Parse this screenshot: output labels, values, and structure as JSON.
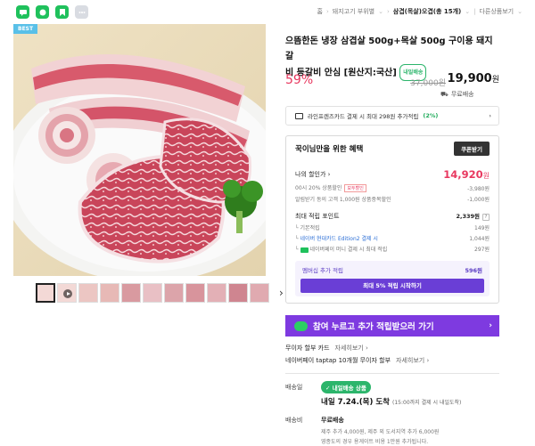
{
  "topbar": {
    "share_icons": [
      "talk-icon",
      "message-icon",
      "bookmark-icon",
      "more-icon"
    ],
    "breadcrumb": [
      {
        "label": "홈"
      },
      {
        "label": "돼지고기 부위별"
      },
      {
        "label": "삼겹(목살)오겹(총 15개)"
      },
      {
        "label": "다른상품보기"
      }
    ]
  },
  "gallery": {
    "badge": "BEST",
    "thumb_count": 11,
    "next_label": "›"
  },
  "product": {
    "title_line1": "으뜸한돈 냉장 삼겹살 500g+목살 500g 구이용 돼지갈",
    "title_line2": "비 등갈비 안심 [원산지:국산]",
    "same_day_badge": "내일배송",
    "discount_rate": "59%",
    "original_price": "37,000원",
    "final_price": "19,900",
    "final_price_unit": "원",
    "shipping_label": "무료배송"
  },
  "card_promo": {
    "text": "라인프렌즈카드 결제 시 최대 298원 추가적립",
    "pct": "(2%)",
    "arrow": "›"
  },
  "benefit": {
    "title": "꾹이님만을 위한 혜택",
    "coupon_button": "쿠폰받기",
    "my_price_label": "나의 할인가",
    "my_price_value": "14,920",
    "my_price_unit": "원",
    "line1_label": "00시 20% 상품할인",
    "line1_tag": "모두할인",
    "line1_value": "-3,980원",
    "line2_label": "알림받기 동의 고객 1,000원 상품중복할인",
    "line2_value": "-1,000원",
    "point_label": "최대 적립 포인트",
    "point_value": "2,339원",
    "base_label": "기본적립",
    "base_value": "149원",
    "card_label": "네이버 현대카드 Edition2 결제 시",
    "card_value": "1,044원",
    "money_label": "네이버페이 머니 결제 시 최대 적립",
    "money_value": "297원",
    "member_label": "멤버십 추가 적립",
    "member_value": "596원",
    "member_button": "최대 5% 적립 시작하기"
  },
  "banner": {
    "text": "참여 누르고 추가 적립받으러 가기",
    "arrow": "›"
  },
  "installment": {
    "row1_label": "무이자 할부 카드",
    "row1_more": "자세히보기",
    "row2_label": "네이버페이 taptap 10개월 무이자 할부",
    "row2_more": "자세히보기"
  },
  "delivery": {
    "label": "배송일",
    "tag": "내일배송 상품",
    "date": "내일 7.24.(목) 도착",
    "date_note": "(15:00까지 결제 시 내일도착)",
    "fee_label": "배송비",
    "fee_main": "무료배송",
    "fee_sub1": "제주 추가 4,000원, 제주 외 도서지역 추가 6,000원",
    "fee_sub2": "영종도의 경우 용게이트 비용 1만원 추가됩니다."
  },
  "colors": {
    "accent_green": "#1fc15c",
    "price_red": "#e8385f",
    "banner_purple": "#7e3ae0",
    "membership_purple": "#6a3ed6"
  }
}
